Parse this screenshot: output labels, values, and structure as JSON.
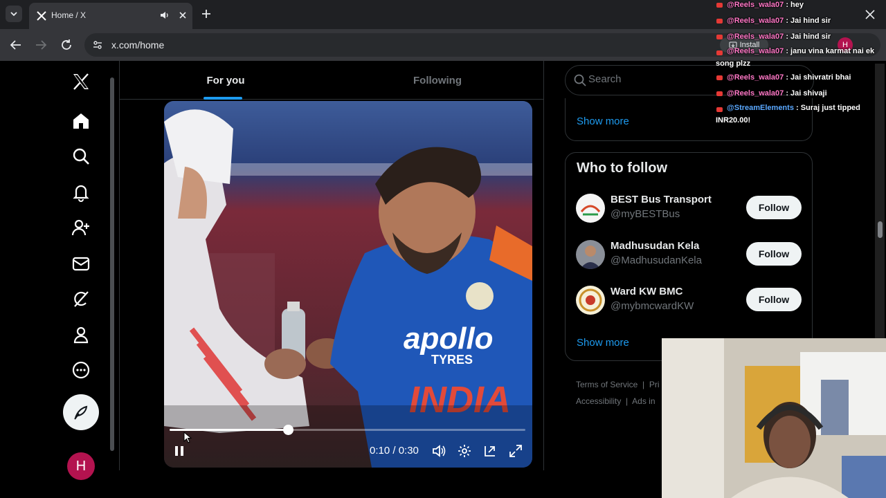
{
  "browser": {
    "tab_title": "Home / X",
    "url": "x.com/home",
    "install_label": "Install",
    "profile_initial": "H"
  },
  "x_nav": {
    "items": [
      "x-logo",
      "home-icon",
      "search-icon",
      "bell-icon",
      "people-icon",
      "mail-icon",
      "grok-icon",
      "profile-icon",
      "more-icon"
    ],
    "avatar_initial": "H"
  },
  "main": {
    "tabs": [
      "For you",
      "Following"
    ],
    "active_tab": "For you",
    "video": {
      "time": "0:10 / 0:30",
      "progress": 0.3333,
      "jersey_text": "apollo TYRES INDIA"
    }
  },
  "right": {
    "search_placeholder": "Search",
    "show_more_1": "Show more",
    "who_to_follow": {
      "title": "Who to follow",
      "accounts": [
        {
          "name": "BEST Bus Transport",
          "handle": "@myBESTBus",
          "button": "Follow"
        },
        {
          "name": "Madhusudan Kela",
          "handle": "@MadhusudanKela",
          "button": "Follow"
        },
        {
          "name": "Ward KW BMC",
          "handle": "@mybmcwardKW",
          "button": "Follow"
        }
      ],
      "show_more": "Show more"
    },
    "footer": {
      "line1": [
        "Terms of Service",
        "|",
        "Pri"
      ],
      "line2": [
        "Accessibility",
        "|",
        "Ads in"
      ]
    }
  },
  "chat": {
    "messages": [
      {
        "user": "@Reels_wala07",
        "text": " : hey"
      },
      {
        "user": "@Reels_wala07",
        "text": " : Jai hind sir"
      },
      {
        "user": "@Reels_wala07",
        "text": " : Jai hind sir"
      },
      {
        "user": "@Reels_wala07",
        "text": " : janu vina karmat nai ek song plzz"
      },
      {
        "user": "@Reels_wala07",
        "text": " : Jai shivratri bhai"
      },
      {
        "user": "@Reels_wala07",
        "text": " : Jai shivaji"
      },
      {
        "user": "@StreamElements",
        "text": " : Suraj just tipped INR20.00!"
      }
    ]
  },
  "colors": {
    "accent": "#1d9bf0",
    "background": "#000000",
    "chat_user": "#ff77c6",
    "avatar": "#b3134f"
  }
}
